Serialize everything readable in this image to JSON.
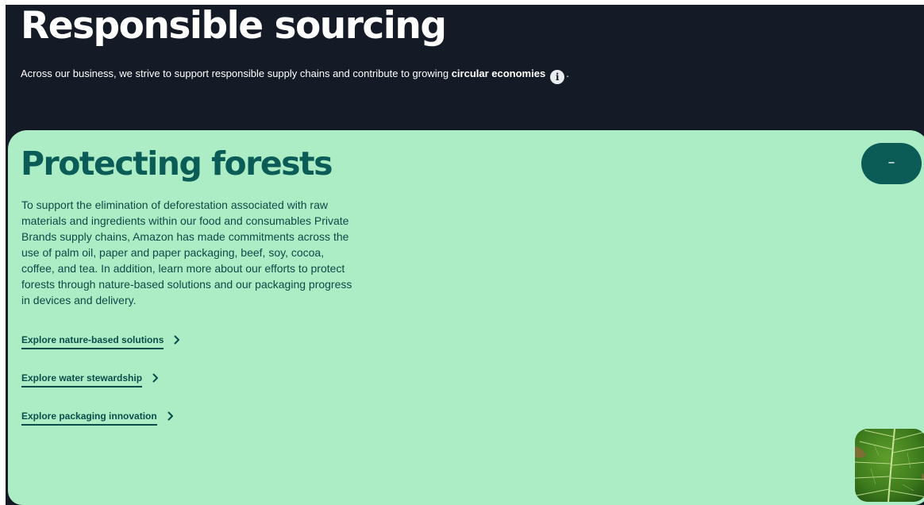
{
  "hero": {
    "title": "Responsible sourcing",
    "intro_text": "Across our business, we strive to support responsible supply chains and contribute to growing",
    "intro_term": "circular economies",
    "info_icon_glyph": "i",
    "intro_end": "."
  },
  "forests_card": {
    "title": "Protecting forests",
    "body": "To support the elimination of deforestation associated with raw materials and ingredients within our food and consumables Private Brands supply chains, Amazon has made commitments across the use of palm oil, paper and paper packaging, beef, soy, cocoa, coffee, and tea. In addition, learn more about our efforts to protect forests through nature-based solutions and our packaging progress in devices and delivery.",
    "collapse_glyph": "–",
    "links": [
      {
        "label": "Explore nature-based solutions"
      },
      {
        "label": "Explore water stewardship"
      },
      {
        "label": "Explore packaging innovation"
      }
    ]
  },
  "icons": {
    "info": "info-icon",
    "chevron": "chevron-right-icon",
    "collapse": "minus-icon",
    "thumbnail": "leaf-image"
  },
  "colors": {
    "hero_bg": "#151b26",
    "card_bg": "#acedc5",
    "accent": "#0b5b57",
    "body_text": "#0e4a47"
  }
}
